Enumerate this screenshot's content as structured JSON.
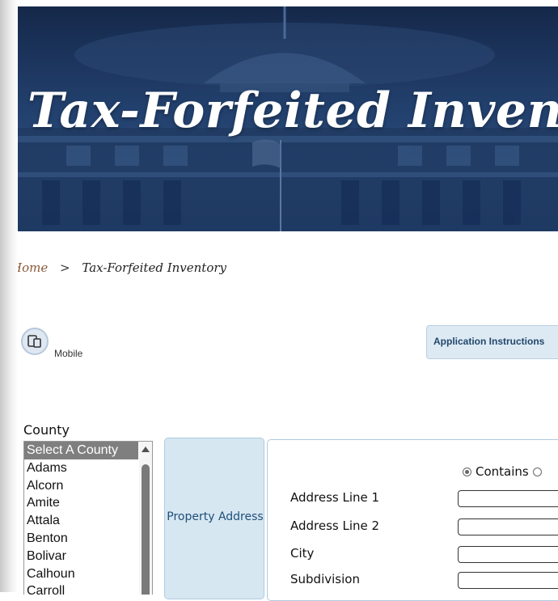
{
  "banner": {
    "title": "Tax-Forfeited Inventory"
  },
  "breadcrumb": {
    "home": "Home",
    "separator": ">",
    "current": "Tax-Forfeited Inventory"
  },
  "toolbar": {
    "mobile_label": "Mobile",
    "mobile_icon": "mobile-devices-icon",
    "instructions_label": "Application Instructions"
  },
  "county": {
    "label": "County",
    "selected": "Select A County",
    "options": [
      "Select A County",
      "Adams",
      "Alcorn",
      "Amite",
      "Attala",
      "Benton",
      "Bolivar",
      "Calhoun",
      "Carroll"
    ]
  },
  "search_tabs": {
    "active": "Property Address"
  },
  "address_form": {
    "match_options": [
      "Contains",
      ""
    ],
    "match_selected": "Contains",
    "fields": [
      {
        "label": "Address Line 1",
        "value": ""
      },
      {
        "label": "Address Line 2",
        "value": ""
      },
      {
        "label": "City",
        "value": ""
      },
      {
        "label": "Subdivision",
        "value": ""
      }
    ]
  },
  "colors": {
    "banner_navy": "#1d355c",
    "tab_blue": "#d6e7f2",
    "accent_text": "#1f4e79",
    "breadcrumb_home": "#8a5a3a"
  }
}
